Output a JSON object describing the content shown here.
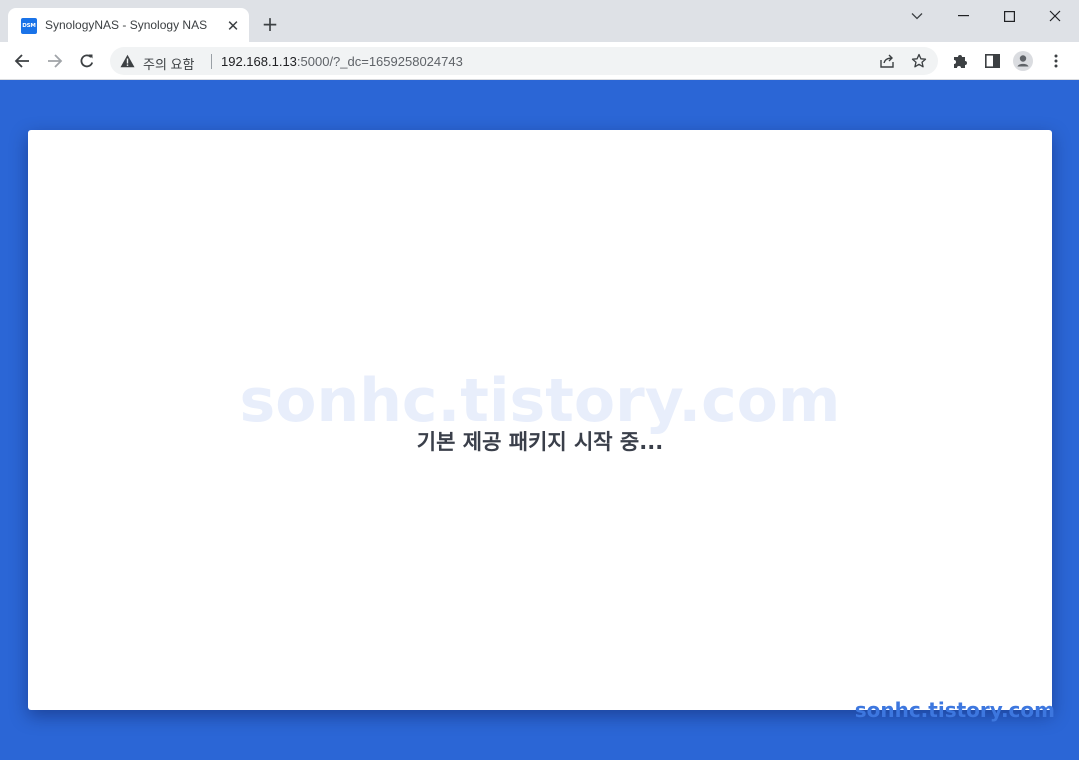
{
  "browser": {
    "tab": {
      "favicon_text": "DSM",
      "title": "SynologyNAS - Synology NAS",
      "close_glyph": "✕"
    },
    "new_tab_glyph": "+",
    "address_bar": {
      "security_label": "주의 요함",
      "url_host": "192.168.1.13",
      "url_rest": ":5000/?_dc=1659258024743"
    },
    "icons": {
      "back": "back-arrow-icon",
      "forward": "forward-arrow-icon",
      "reload": "reload-icon",
      "share": "share-icon",
      "bookmark": "star-icon",
      "extensions": "puzzle-icon",
      "side_panel": "side-panel-icon",
      "profile": "profile-icon",
      "menu": "kebab-menu-icon"
    },
    "colors": {
      "tabbar": "#dee1e6",
      "toolbar": "#ffffff",
      "omnibox": "#f1f3f4"
    }
  },
  "page": {
    "status_text": "기본 제공 패키지 시작 중...",
    "watermark": "sonhc.tistory.com",
    "corner_watermark": "sonhc.tistory.com",
    "colors": {
      "background": "#2b66d6",
      "card": "#ffffff"
    }
  }
}
